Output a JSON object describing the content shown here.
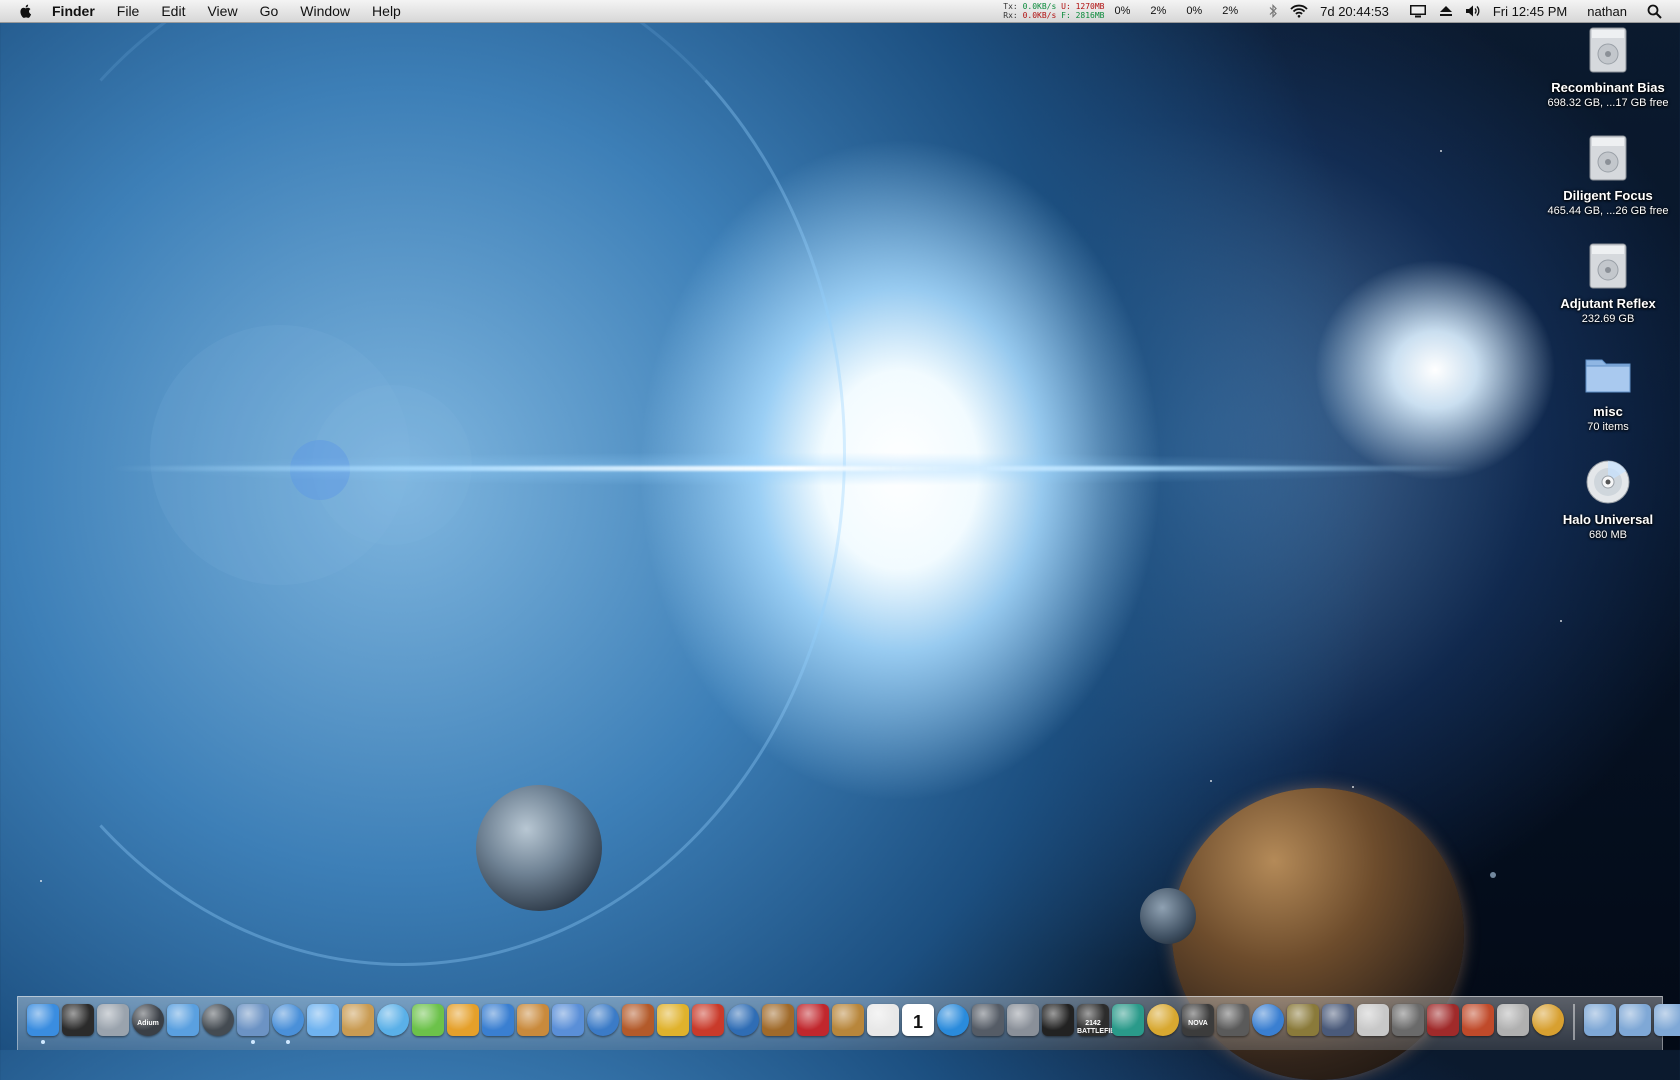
{
  "menubar": {
    "app_name": "Finder",
    "items": [
      "File",
      "Edit",
      "View",
      "Go",
      "Window",
      "Help"
    ],
    "netstat": {
      "tx_label": "Tx:",
      "tx_value": "0.0KB/s",
      "rx_label": "Rx:",
      "rx_value": "0.0KB/s",
      "u_label": "U:",
      "u_value": "1270MB",
      "f_label": "F:",
      "f_value": "2816MB"
    },
    "cpu": [
      "0%",
      "2%",
      "0%",
      "2%"
    ],
    "uptime": "7d 20:44:53",
    "clock": "Fri 12:45 PM",
    "user": "nathan"
  },
  "desktop_icons": [
    {
      "name": "Recombinant Bias",
      "info": "698.32 GB, ...17 GB free",
      "icon": "hard-drive-icon"
    },
    {
      "name": "Diligent Focus",
      "info": "465.44 GB, ...26 GB free",
      "icon": "hard-drive-icon"
    },
    {
      "name": "Adjutant Reflex",
      "info": "232.69 GB",
      "icon": "hard-drive-icon"
    },
    {
      "name": "misc",
      "info": "70 items",
      "icon": "folder-icon"
    },
    {
      "name": "Halo Universal",
      "info": "680 MB",
      "icon": "cd-icon"
    }
  ],
  "dock": {
    "adium_label": "Adium",
    "calendar_day": "1",
    "battlefield_label": "2142 BATTLEFIELD",
    "nova_label": "NOVA",
    "icons": [
      {
        "name": "finder",
        "color": "#3a8de0",
        "running": true
      },
      {
        "name": "activity-monitor",
        "color": "#2b2b2b",
        "running": false
      },
      {
        "name": "disk-utility",
        "color": "#9aa3ad",
        "running": false
      },
      {
        "name": "adium",
        "color": "#3a3f46",
        "running": false
      },
      {
        "name": "ichat-users",
        "color": "#5aa0e0",
        "running": false
      },
      {
        "name": "dashboard",
        "color": "#444b52",
        "running": false
      },
      {
        "name": "preview",
        "color": "#6c93c4",
        "running": true
      },
      {
        "name": "safari",
        "color": "#4a90d9",
        "running": true
      },
      {
        "name": "ichat",
        "color": "#6fb3f0",
        "running": false
      },
      {
        "name": "address-book",
        "color": "#c99b52",
        "running": false
      },
      {
        "name": "itunes",
        "color": "#5ab0e8",
        "running": false
      },
      {
        "name": "dreamweaver",
        "color": "#6cc24a",
        "running": false
      },
      {
        "name": "fireworks",
        "color": "#e5a02a",
        "running": false
      },
      {
        "name": "word",
        "color": "#3a7fd1",
        "running": false
      },
      {
        "name": "iphoto",
        "color": "#c98a3c",
        "running": false
      },
      {
        "name": "imovie",
        "color": "#5a8fd8",
        "running": false
      },
      {
        "name": "dvd-player",
        "color": "#3b7bc7",
        "running": false
      },
      {
        "name": "garageband",
        "color": "#b35a2a",
        "running": false
      },
      {
        "name": "smultron",
        "color": "#e0b22c",
        "running": false
      },
      {
        "name": "toast",
        "color": "#c93a2a",
        "running": false
      },
      {
        "name": "google-earth",
        "color": "#2f6db5",
        "running": false
      },
      {
        "name": "guitar",
        "color": "#a06a2a",
        "running": false
      },
      {
        "name": "photo-booth",
        "color": "#c1272d",
        "running": false
      },
      {
        "name": "iweb",
        "color": "#b8863b",
        "running": false
      },
      {
        "name": "textedit",
        "color": "#e8e8e8",
        "running": false
      },
      {
        "name": "ical",
        "color": "#ffffff",
        "running": false
      },
      {
        "name": "quicktime",
        "color": "#2a8bdc",
        "running": false
      },
      {
        "name": "expose",
        "color": "#555c66",
        "running": false
      },
      {
        "name": "system-preferences",
        "color": "#8a9099",
        "running": false
      },
      {
        "name": "x11",
        "color": "#222222",
        "running": false
      },
      {
        "name": "battlefield-2142",
        "color": "#2c2c2c",
        "running": false
      },
      {
        "name": "cyberduck",
        "color": "#2a9a8a",
        "running": false
      },
      {
        "name": "fallout",
        "color": "#d8a830",
        "running": false
      },
      {
        "name": "nova",
        "color": "#3c3c3c",
        "running": false
      },
      {
        "name": "pickaxe",
        "color": "#5a5a5a",
        "running": false
      },
      {
        "name": "app-store-a",
        "color": "#3a7fd1",
        "running": false
      },
      {
        "name": "game-warrior",
        "color": "#8a7a3a",
        "running": false
      },
      {
        "name": "rosetta",
        "color": "#4a5a7a",
        "running": false
      },
      {
        "name": "map",
        "color": "#c8c8c8",
        "running": false
      },
      {
        "name": "starcraft",
        "color": "#6a6a6a",
        "running": false
      },
      {
        "name": "quake",
        "color": "#a02a2a",
        "running": false
      },
      {
        "name": "warcraft-emblem",
        "color": "#c04a2a",
        "running": false
      },
      {
        "name": "warcraft-emblem-2",
        "color": "#b0b0b0",
        "running": false
      },
      {
        "name": "world-of-warcraft",
        "color": "#d8a030",
        "running": false
      }
    ],
    "right_icons": [
      {
        "name": "movies-folder",
        "color": "#7fa8d6"
      },
      {
        "name": "documents-folder",
        "color": "#7fa8d6"
      },
      {
        "name": "downloads-folder",
        "color": "#7fa8d6"
      },
      {
        "name": "trash",
        "color": "#c8cdd3"
      }
    ]
  }
}
